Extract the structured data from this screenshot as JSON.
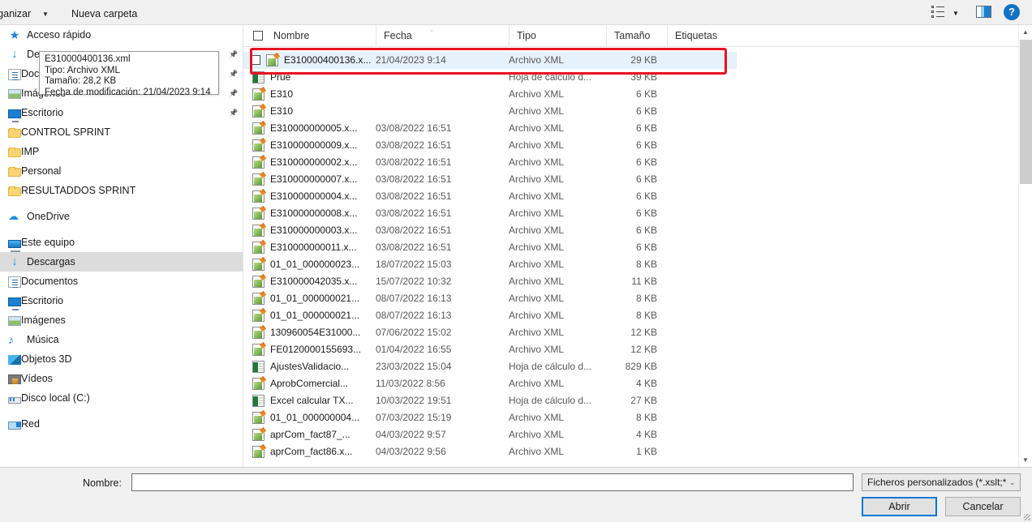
{
  "toolbar": {
    "organizar_label": "rganizar",
    "organizar_caret": "▼",
    "nueva_carpeta_label": "Nueva carpeta",
    "views_caret": "▼",
    "help_label": "?"
  },
  "sidebar": {
    "groups": [
      {
        "items": [
          {
            "label": "Acceso rápido",
            "icon": "star-icon",
            "pinned": false,
            "selected": false
          },
          {
            "label": "Descargas",
            "icon": "download-icon",
            "pinned": true,
            "selected": false
          },
          {
            "label": "Documentos",
            "icon": "documents-icon",
            "pinned": true,
            "selected": false
          },
          {
            "label": "Imágenes",
            "icon": "pictures-icon",
            "pinned": true,
            "selected": false
          },
          {
            "label": "Escritorio",
            "icon": "desktop-icon",
            "pinned": true,
            "selected": false
          },
          {
            "label": "CONTROL SPRINT",
            "icon": "folder-icon",
            "pinned": false,
            "selected": false
          },
          {
            "label": "IMP",
            "icon": "folder-icon",
            "pinned": false,
            "selected": false
          },
          {
            "label": "Personal",
            "icon": "folder-icon",
            "pinned": false,
            "selected": false
          },
          {
            "label": "RESULTADDOS SPRINT",
            "icon": "folder-icon",
            "pinned": false,
            "selected": false
          }
        ]
      },
      {
        "items": [
          {
            "label": "OneDrive",
            "icon": "onedrive-icon",
            "pinned": false,
            "selected": false
          }
        ]
      },
      {
        "items": [
          {
            "label": "Este equipo",
            "icon": "this-pc-icon",
            "pinned": false,
            "selected": false
          },
          {
            "label": "Descargas",
            "icon": "download-icon",
            "pinned": false,
            "selected": true
          },
          {
            "label": "Documentos",
            "icon": "documents-icon",
            "pinned": false,
            "selected": false
          },
          {
            "label": "Escritorio",
            "icon": "desktop-icon",
            "pinned": false,
            "selected": false
          },
          {
            "label": "Imágenes",
            "icon": "pictures-icon",
            "pinned": false,
            "selected": false
          },
          {
            "label": "Música",
            "icon": "music-icon",
            "pinned": false,
            "selected": false
          },
          {
            "label": "Objetos 3D",
            "icon": "3d-objects-icon",
            "pinned": false,
            "selected": false
          },
          {
            "label": "Vídeos",
            "icon": "videos-icon",
            "pinned": false,
            "selected": false
          },
          {
            "label": "Disco local (C:)",
            "icon": "disk-icon",
            "pinned": false,
            "selected": false
          }
        ]
      },
      {
        "items": [
          {
            "label": "Red",
            "icon": "network-icon",
            "pinned": false,
            "selected": false
          }
        ]
      }
    ]
  },
  "file_list": {
    "columns": [
      "Nombre",
      "Fecha",
      "Tipo",
      "Tamaño",
      "Etiquetas"
    ],
    "sort_indicator": "descending",
    "sort_column": "Fecha",
    "select_all_checked": false,
    "rows": [
      {
        "name": "E310000400136.x...",
        "date": "21/04/2023 9:14",
        "type": "Archivo XML",
        "size": "29 KB",
        "icon": "xml-file-icon",
        "selected": true
      },
      {
        "name": "Prue",
        "date": "",
        "type": "Hoja de cálculo d...",
        "size": "39 KB",
        "icon": "excel-file-icon",
        "selected": false
      },
      {
        "name": "E310",
        "date": "",
        "type": "Archivo XML",
        "size": "6 KB",
        "icon": "xml-file-icon",
        "selected": false
      },
      {
        "name": "E310",
        "date": "",
        "type": "Archivo XML",
        "size": "6 KB",
        "icon": "xml-file-icon",
        "selected": false
      },
      {
        "name": "E310000000005.x...",
        "date": "03/08/2022 16:51",
        "type": "Archivo XML",
        "size": "6 KB",
        "icon": "xml-file-icon",
        "selected": false
      },
      {
        "name": "E310000000009.x...",
        "date": "03/08/2022 16:51",
        "type": "Archivo XML",
        "size": "6 KB",
        "icon": "xml-file-icon",
        "selected": false
      },
      {
        "name": "E310000000002.x...",
        "date": "03/08/2022 16:51",
        "type": "Archivo XML",
        "size": "6 KB",
        "icon": "xml-file-icon",
        "selected": false
      },
      {
        "name": "E310000000007.x...",
        "date": "03/08/2022 16:51",
        "type": "Archivo XML",
        "size": "6 KB",
        "icon": "xml-file-icon",
        "selected": false
      },
      {
        "name": "E310000000004.x...",
        "date": "03/08/2022 16:51",
        "type": "Archivo XML",
        "size": "6 KB",
        "icon": "xml-file-icon",
        "selected": false
      },
      {
        "name": "E310000000008.x...",
        "date": "03/08/2022 16:51",
        "type": "Archivo XML",
        "size": "6 KB",
        "icon": "xml-file-icon",
        "selected": false
      },
      {
        "name": "E310000000003.x...",
        "date": "03/08/2022 16:51",
        "type": "Archivo XML",
        "size": "6 KB",
        "icon": "xml-file-icon",
        "selected": false
      },
      {
        "name": "E310000000011.x...",
        "date": "03/08/2022 16:51",
        "type": "Archivo XML",
        "size": "6 KB",
        "icon": "xml-file-icon",
        "selected": false
      },
      {
        "name": "01_01_000000023...",
        "date": "18/07/2022 15:03",
        "type": "Archivo XML",
        "size": "8 KB",
        "icon": "xml-file-icon",
        "selected": false
      },
      {
        "name": "E310000042035.x...",
        "date": "15/07/2022 10:32",
        "type": "Archivo XML",
        "size": "11 KB",
        "icon": "xml-file-icon",
        "selected": false
      },
      {
        "name": "01_01_000000021...",
        "date": "08/07/2022 16:13",
        "type": "Archivo XML",
        "size": "8 KB",
        "icon": "xml-file-icon",
        "selected": false
      },
      {
        "name": "01_01_000000021...",
        "date": "08/07/2022 16:13",
        "type": "Archivo XML",
        "size": "8 KB",
        "icon": "xml-file-icon",
        "selected": false
      },
      {
        "name": "130960054E31000...",
        "date": "07/06/2022 15:02",
        "type": "Archivo XML",
        "size": "12 KB",
        "icon": "xml-file-icon",
        "selected": false
      },
      {
        "name": "FE0120000155693...",
        "date": "01/04/2022 16:55",
        "type": "Archivo XML",
        "size": "12 KB",
        "icon": "xml-file-icon",
        "selected": false
      },
      {
        "name": "AjustesValidacio...",
        "date": "23/03/2022 15:04",
        "type": "Hoja de cálculo d...",
        "size": "829 KB",
        "icon": "excel-file-icon",
        "selected": false
      },
      {
        "name": "AprobComercial...",
        "date": "11/03/2022 8:56",
        "type": "Archivo XML",
        "size": "4 KB",
        "icon": "xml-file-icon",
        "selected": false
      },
      {
        "name": "Excel calcular TX...",
        "date": "10/03/2022 19:51",
        "type": "Hoja de cálculo d...",
        "size": "27 KB",
        "icon": "excel-file-icon",
        "selected": false
      },
      {
        "name": "01_01_000000004...",
        "date": "07/03/2022 15:19",
        "type": "Archivo XML",
        "size": "8 KB",
        "icon": "xml-file-icon",
        "selected": false
      },
      {
        "name": "aprCom_fact87_...",
        "date": "04/03/2022 9:57",
        "type": "Archivo XML",
        "size": "4 KB",
        "icon": "xml-file-icon",
        "selected": false
      },
      {
        "name": "aprCom_fact86.x...",
        "date": "04/03/2022 9:56",
        "type": "Archivo XML",
        "size": "1 KB",
        "icon": "xml-file-icon",
        "selected": false
      }
    ]
  },
  "tooltip": {
    "line1": "E310000400136.xml",
    "line2": "Tipo: Archivo XML",
    "line3": "Tamaño: 28,2 KB",
    "line4": "Fecha de modificación: 21/04/2023 9:14"
  },
  "footer": {
    "name_label": "Nombre:",
    "name_value": "",
    "name_placeholder": "",
    "filter_value": "Ficheros personalizados (*.xslt;*",
    "filter_caret": "⌄",
    "open_label": "Abrir",
    "cancel_label": "Cancelar"
  },
  "scrollbar": {
    "up_arrow": "▲",
    "down_arrow": "▼"
  },
  "colors": {
    "accent": "#0078d7",
    "selection": "#e5f1fb",
    "annotation": "#e81123",
    "sidebar_selected": "#dcdcdc"
  }
}
